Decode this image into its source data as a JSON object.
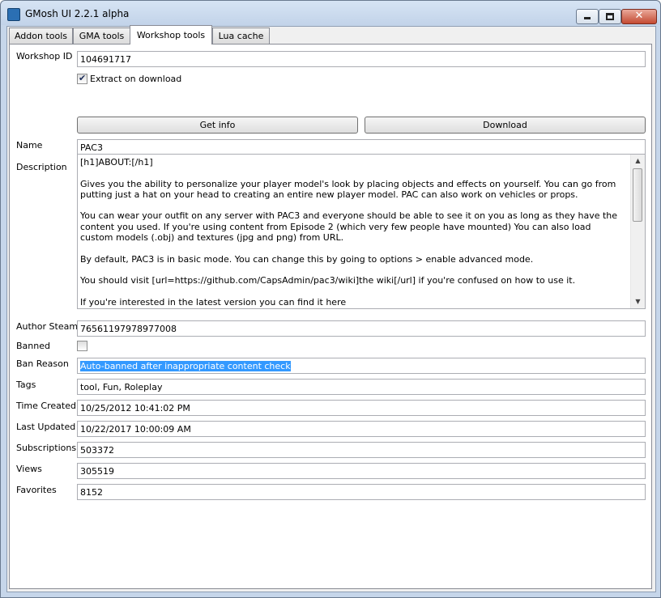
{
  "window": {
    "title": "GMosh UI 2.2.1 alpha",
    "close_glyph": "✕"
  },
  "tabs": [
    {
      "label": "Addon tools"
    },
    {
      "label": "GMA tools"
    },
    {
      "label": "Workshop tools"
    },
    {
      "label": "Lua cache"
    }
  ],
  "active_tab": "Workshop tools",
  "form": {
    "workshop_id": {
      "label": "Workshop ID",
      "value": "104691717"
    },
    "extract": {
      "label": "Extract on download",
      "checked": true
    },
    "buttons": {
      "get_info": "Get info",
      "download": "Download"
    },
    "name": {
      "label": "Name",
      "value": "PAC3"
    },
    "description": {
      "label": "Description",
      "paragraphs": [
        "[h1]ABOUT:[/h1]",
        "Gives you the ability to personalize your player model's look by placing objects and effects on yourself. You can go from putting just a hat on your head to creating an entire new player model. PAC can also work on vehicles or props.",
        "You can wear your outfit on any server with PAC3 and everyone should be able to see it on you as long as they have the content you used. If you're using content from Episode 2 (which very few people have mounted) You can also load custom models (.obj) and textures (jpg and png) from URL.",
        "By default, PAC3 is in basic mode. You can change this by going to options > enable advanced mode.",
        "You should visit [url=https://github.com/CapsAdmin/pac3/wiki]the wiki[/url] if you're confused on how to use it.",
        "If you're interested in the latest version you can find it here"
      ]
    },
    "author_steam": {
      "label": "Author Steam",
      "value": "76561197978977008"
    },
    "banned": {
      "label": "Banned",
      "checked": false
    },
    "ban_reason": {
      "label": "Ban Reason",
      "value": "Auto-banned after inappropriate content check"
    },
    "tags": {
      "label": "Tags",
      "value": "tool, Fun, Roleplay"
    },
    "time_created": {
      "label": "Time Created",
      "value": "10/25/2012 10:41:02 PM"
    },
    "last_updated": {
      "label": "Last Updated",
      "value": "10/22/2017 10:00:09 AM"
    },
    "subscriptions": {
      "label": "Subscriptions",
      "value": "503372"
    },
    "views": {
      "label": "Views",
      "value": "305519"
    },
    "favorites": {
      "label": "Favorites",
      "value": "8152"
    }
  },
  "colors": {
    "selection": "#3399ff",
    "title_bar": "#c6d6ea",
    "close_button": "#c44a32"
  },
  "icons": {
    "app": "app-icon",
    "minimize": "minimize-icon",
    "maximize": "maximize-icon",
    "close": "close-icon",
    "check": "checkmark-icon"
  }
}
